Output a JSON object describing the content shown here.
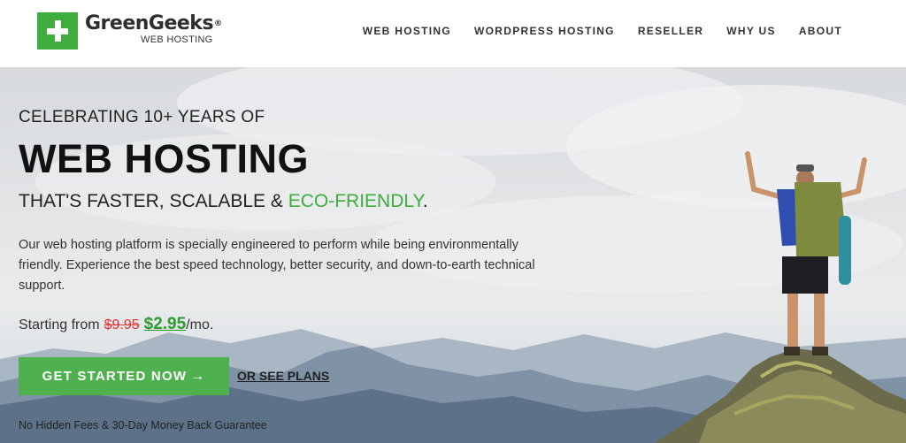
{
  "brand": {
    "name": "GreenGeeks",
    "registered": "®",
    "tagline": "WEB HOSTING",
    "color": "#3ead3e"
  },
  "nav": {
    "items": [
      {
        "label": "WEB HOSTING"
      },
      {
        "label": "WORDPRESS HOSTING"
      },
      {
        "label": "RESELLER"
      },
      {
        "label": "WHY US"
      },
      {
        "label": "ABOUT"
      }
    ]
  },
  "hero": {
    "eyebrow": "CELEBRATING 10+ YEARS OF",
    "headline": "WEB HOSTING",
    "subhead_prefix": "THAT'S FASTER, SCALABLE & ",
    "subhead_highlight": "ECO-FRIENDLY",
    "subhead_suffix": ".",
    "description": "Our web hosting platform is specially engineered to perform while being environmentally friendly. Experience the best speed technology, better security, and down-to-earth technical support.",
    "price": {
      "prefix": "Starting from",
      "old": "$9.95",
      "new": "$2.95",
      "suffix": "/mo."
    },
    "cta_label": "GET STARTED NOW",
    "cta_arrow": "→",
    "see_plans_label": "OR SEE PLANS",
    "guarantee": "No Hidden Fees & 30-Day Money Back Guarantee"
  },
  "colors": {
    "accent": "#3ead3e",
    "button": "#4fb04f",
    "old_price": "#d33333",
    "new_price": "#2f9a2f"
  }
}
